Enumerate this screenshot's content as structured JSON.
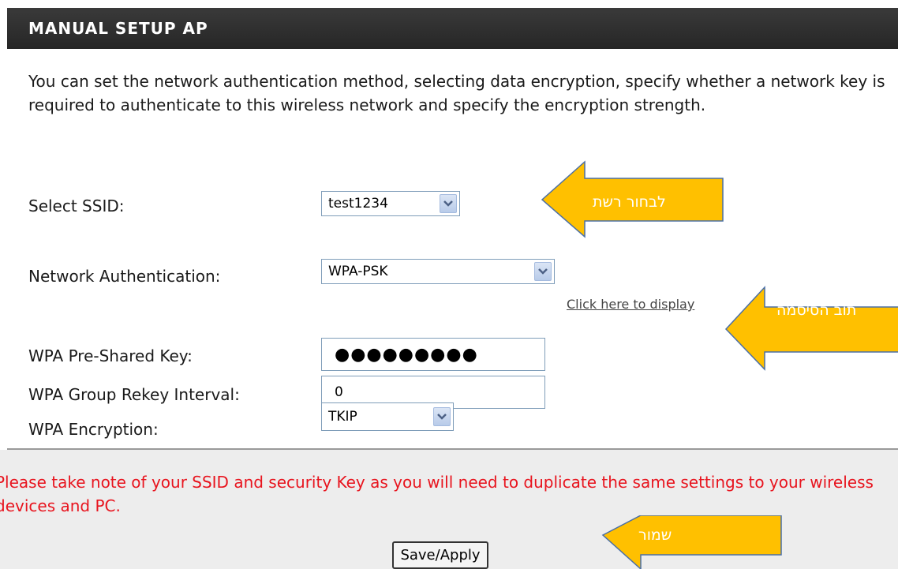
{
  "header": {
    "title": "MANUAL SETUP AP"
  },
  "description": "You can set the network authentication method, selecting data encryption, specify whether a network key is required to authenticate to this wireless network and specify the encryption strength.",
  "form": {
    "ssid": {
      "label": "Select SSID:",
      "value": "test1234"
    },
    "auth": {
      "label": "Network Authentication:",
      "value": "WPA-PSK"
    },
    "psk": {
      "label": "WPA Pre-Shared Key:",
      "value": "●●●●●●●●●",
      "link": "Click here to display"
    },
    "rekey": {
      "label": "WPA Group Rekey Interval:",
      "value": "0"
    },
    "encryption": {
      "label": "WPA Encryption:",
      "value": "TKIP"
    }
  },
  "note": "Please take note of your SSID and security Key as you will need to duplicate the same settings to your wireless devices and PC.",
  "buttons": {
    "save": "Save/Apply"
  },
  "callouts": {
    "ssid": "לבחור רשת",
    "password": "תוב הסיסמה",
    "save": "שמור",
    "color": "#ffc000"
  }
}
